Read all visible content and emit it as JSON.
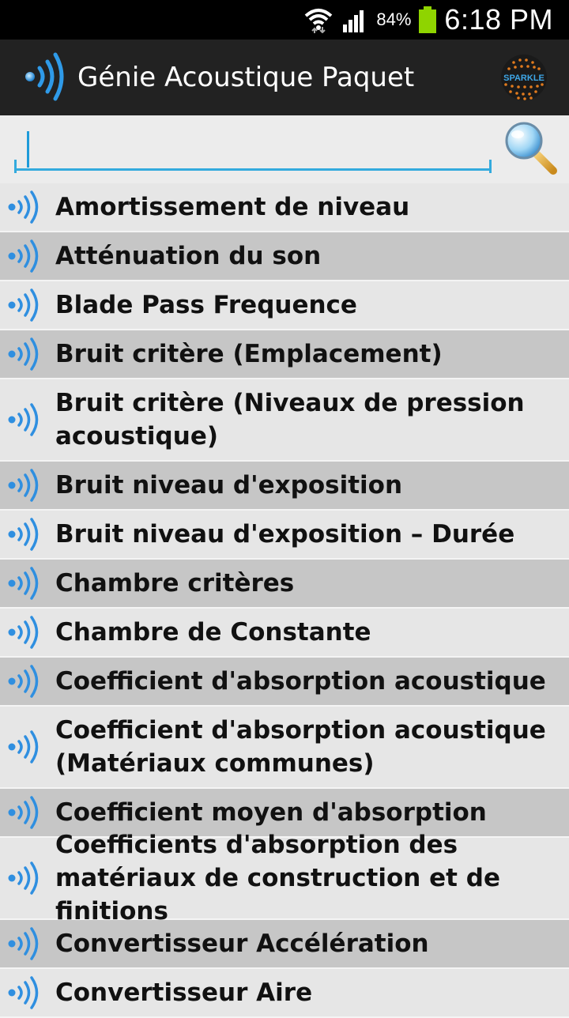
{
  "status": {
    "time": "6:18 PM",
    "battery": "84%",
    "battery_color": "#8fd400"
  },
  "actionbar": {
    "title": "Génie Acoustique Paquet",
    "logo_icon": "sound-wave-icon",
    "brand_icon": "sparkle-globe-logo",
    "brand_text": "SPARKLE"
  },
  "search": {
    "value": "",
    "placeholder": "",
    "accent": "#33aadd"
  },
  "list": {
    "items": [
      {
        "label": "Amortissement de niveau"
      },
      {
        "label": "Atténuation du son"
      },
      {
        "label": "Blade Pass Frequence"
      },
      {
        "label": "Bruit critère (Emplacement)"
      },
      {
        "label": "Bruit critère (Niveaux de pression acoustique)"
      },
      {
        "label": "Bruit niveau d'exposition"
      },
      {
        "label": "Bruit niveau d'exposition – Durée"
      },
      {
        "label": "Chambre critères"
      },
      {
        "label": "Chambre de Constante"
      },
      {
        "label": "Coefficient d'absorption acoustique"
      },
      {
        "label": "Coefficient d'absorption acoustique (Matériaux communes)"
      },
      {
        "label": "Coefficient moyen d'absorption"
      },
      {
        "label": "Coefficients d'absorption des matériaux de construction et de finitions"
      },
      {
        "label": "Convertisseur Accélération"
      },
      {
        "label": "Convertisseur Aire"
      }
    ]
  }
}
